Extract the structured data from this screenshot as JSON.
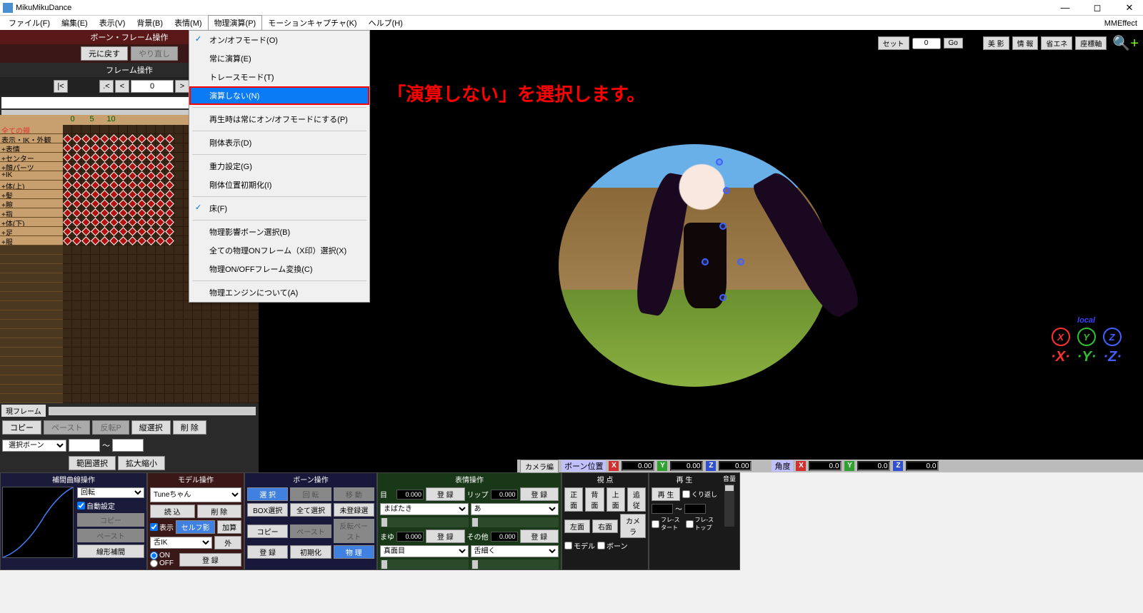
{
  "title": "MikuMikuDance",
  "mme": "MMEffect",
  "menu": [
    "ファイル(F)",
    "編集(E)",
    "表示(V)",
    "背景(B)",
    "表情(M)",
    "物理演算(P)",
    "モーションキャプチャ(K)",
    "ヘルプ(H)"
  ],
  "active_menu_idx": 5,
  "dropdown": {
    "groups": [
      [
        {
          "label": "オン/オフモード(O)",
          "checked": true
        },
        {
          "label": "常に演算(E)"
        },
        {
          "label": "トレースモード(T)"
        },
        {
          "label": "演算しない(N)",
          "highlight": true
        }
      ],
      [
        {
          "label": "再生時は常にオン/オフモードにする(P)"
        }
      ],
      [
        {
          "label": "剛体表示(D)"
        }
      ],
      [
        {
          "label": "重力設定(G)"
        },
        {
          "label": "剛体位置初期化(I)"
        }
      ],
      [
        {
          "label": "床(F)",
          "checked": true
        }
      ],
      [
        {
          "label": "物理影響ボーン選択(B)"
        },
        {
          "label": "全ての物理ONフレーム（X印）選択(X)"
        },
        {
          "label": "物理ON/OFFフレーム変換(C)"
        }
      ],
      [
        {
          "label": "物理エンジンについて(A)"
        }
      ]
    ]
  },
  "overlay_text": "「演算しない」を選択します。",
  "left": {
    "bone_title": "ボーン・フレーム操作",
    "undo": "元に戻す",
    "redo": "やり直し",
    "frame_title": "フレーム操作",
    "frame_value": "0",
    "ruler": [
      "0",
      "5",
      "10"
    ],
    "tracks": [
      "全ての親",
      "表示・IK・外観",
      "+表情",
      "+センター",
      "+顔パーツ",
      "+IK",
      "+体(上)",
      "+髪",
      "+腕",
      "+指",
      "+体(下)",
      "+足",
      "+服"
    ],
    "curr_frame": "現フレーム",
    "btns": {
      "copy": "コピー",
      "paste": "ペースト",
      "reverse": "反転P",
      "vsel": "縦選択",
      "delete": "削 除",
      "range": "範囲選択",
      "zoom": "拡大縮小"
    },
    "sel_bone": "選択ボーン"
  },
  "vp_toolbar": {
    "set": "セット",
    "set_val": "0",
    "go": "Go",
    "beauty": "美 影",
    "info": "情 報",
    "eco": "省エネ",
    "axis": "座標軸"
  },
  "axis_w": {
    "local": "local"
  },
  "coord": {
    "cam": "カメラ編",
    "pos": "ボーン位置",
    "ang": "角度",
    "x": "0.00",
    "y": "0.00",
    "z": "0.00",
    "rx": "0.0",
    "ry": "0.0",
    "rz": "0.0"
  },
  "p1": {
    "title": "補間曲線操作",
    "rot": "回転",
    "auto": "自動設定",
    "copy": "コピー",
    "paste": "ペースト",
    "linear": "線形補間"
  },
  "p2": {
    "title": "モデル操作",
    "model": "Tuneちゃん",
    "load": "読 込",
    "del": "削 除",
    "show": "表示",
    "selfshadow": "セルフ影",
    "add": "加算",
    "tongue": "舌IK",
    "out": "外",
    "on": "ON",
    "off": "OFF",
    "reg": "登 録"
  },
  "p3": {
    "title": "ボーン操作",
    "select": "選 択",
    "rotate": "回 転",
    "move": "移 動",
    "boxsel": "BOX選択",
    "allsel": "全て選択",
    "unreg": "未登録選",
    "copy": "コピー",
    "paste": "ペースト",
    "revpaste": "反転ペースト",
    "reg": "登 録",
    "init": "初期化",
    "phys": "物 理"
  },
  "p4": {
    "title": "表情操作",
    "eye": "目",
    "eye_v": "0.000",
    "reg": "登 録",
    "lip": "リップ",
    "lip_v": "0.000",
    "blink": "まばたき",
    "a": "あ",
    "brow": "まゆ",
    "brow_v": "0.000",
    "other": "その他",
    "other_v": "0.000",
    "serious": "真面目",
    "tongue": "舌細く"
  },
  "p5": {
    "title": "視  点",
    "front": "正面",
    "back": "背面",
    "top": "上面",
    "follow": "追従",
    "left": "左面",
    "right": "右面",
    "cam": "カメラ",
    "model": "モデル",
    "bone": "ボーン"
  },
  "p6": {
    "play_t": "再  生",
    "play": "再 生",
    "repeat": "くり返し",
    "fstart": "フレ-スタート",
    "fstop": "フレ-ストップ",
    "vol": "音量"
  }
}
